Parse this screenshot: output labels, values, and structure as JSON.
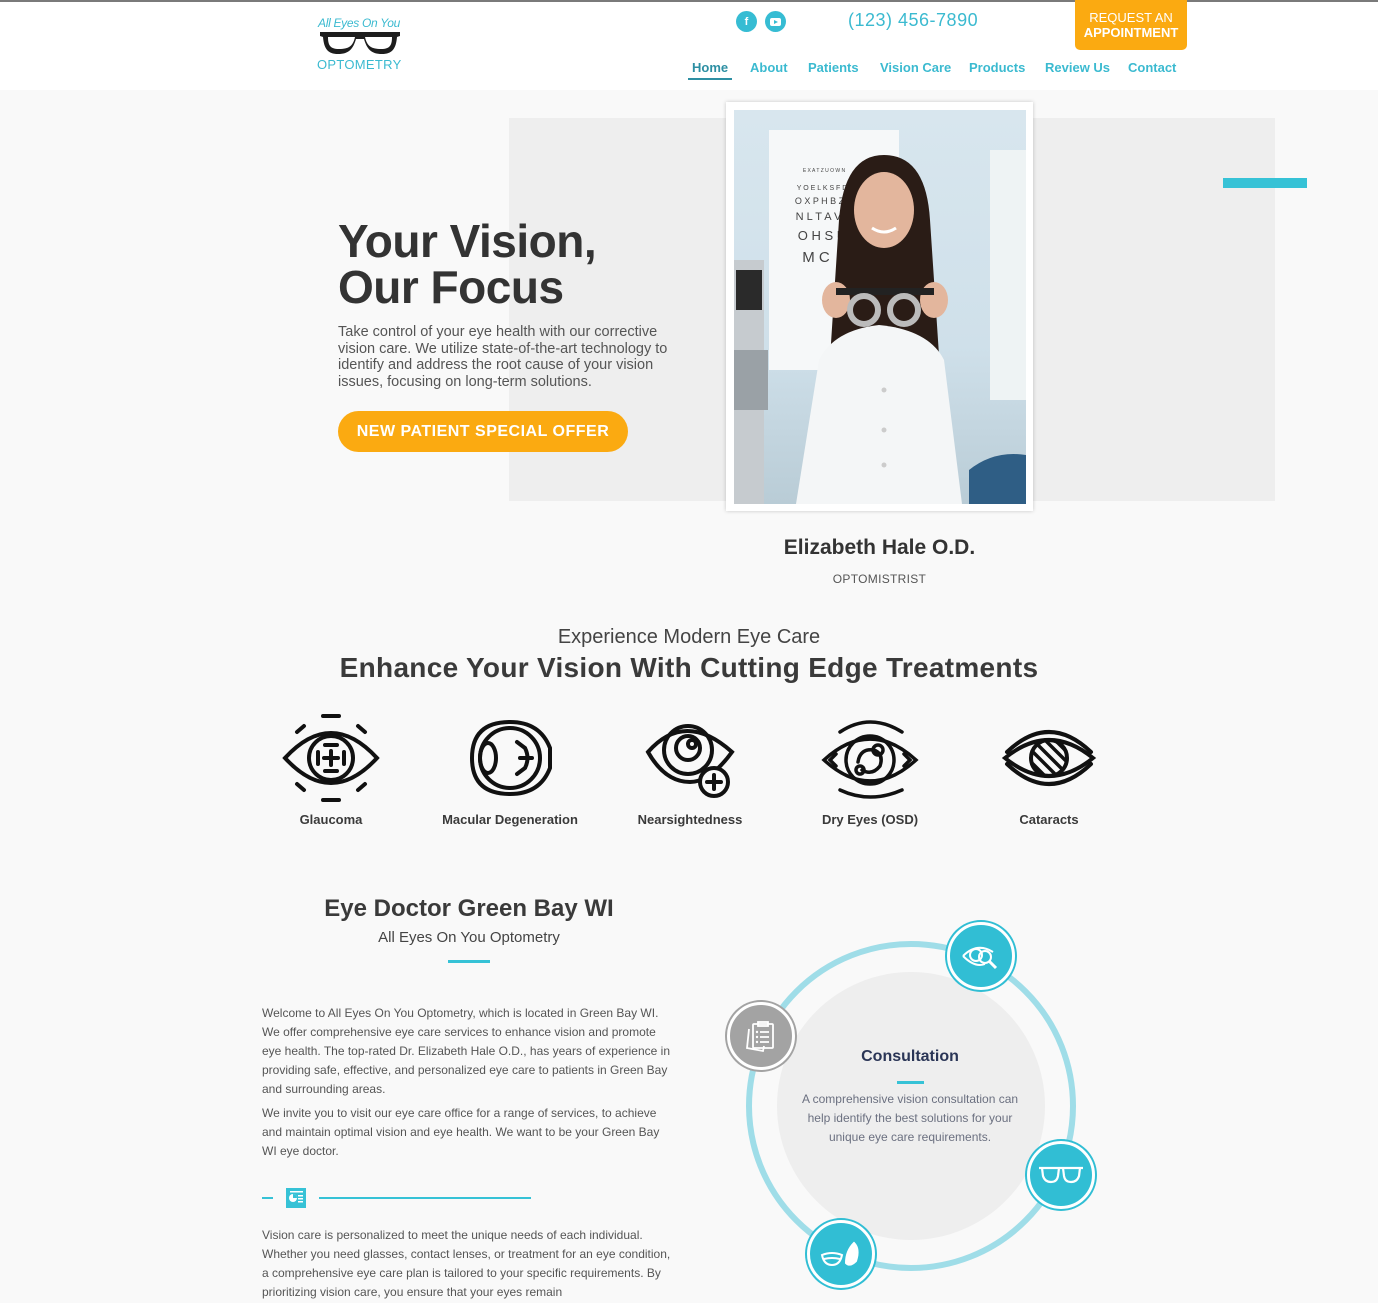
{
  "brand": {
    "logo_top": "All Eyes On You",
    "logo_bottom": "OPTOMETRY"
  },
  "header": {
    "social": [
      {
        "icon": "facebook-icon",
        "glyph": "f"
      },
      {
        "icon": "youtube-icon",
        "glyph": "▶"
      }
    ],
    "phone": "(123) 456-7890",
    "request_line1": "REQUEST AN",
    "request_line2": "APPOINTMENT"
  },
  "nav": {
    "items": [
      {
        "label": "Home",
        "active": true
      },
      {
        "label": "About"
      },
      {
        "label": "Patients"
      },
      {
        "label": "Vision Care"
      },
      {
        "label": "Products"
      },
      {
        "label": "Review Us"
      },
      {
        "label": "Contact"
      }
    ]
  },
  "hero": {
    "title_line1": "Your Vision,",
    "title_line2": "Our Focus",
    "text": "Take control of your eye health with our corrective vision care. We utilize state-of-the-art technology to identify and address the root cause of your vision issues, focusing on long-term solutions.",
    "cta": "NEW PATIENT SPECIAL OFFER",
    "doctor_name": "Elizabeth Hale O.D.",
    "doctor_title": "OPTOMISTRIST",
    "photo_alt": "Optometrist holding trial frame"
  },
  "treatments": {
    "subtitle": "Experience Modern Eye Care",
    "title": "Enhance Your Vision With Cutting Edge Treatments",
    "items": [
      {
        "label": "Glaucoma",
        "icon": "glaucoma-eye-icon"
      },
      {
        "label": "Macular Degeneration",
        "icon": "macular-eye-icon"
      },
      {
        "label": "Nearsightedness",
        "icon": "nearsighted-eye-icon"
      },
      {
        "label": "Dry Eyes (OSD)",
        "icon": "dry-eye-icon"
      },
      {
        "label": "Cataracts",
        "icon": "cataract-eye-icon"
      }
    ]
  },
  "about": {
    "title": "Eye Doctor Green Bay WI",
    "subtitle": "All Eyes On You Optometry",
    "para1": "Welcome to All Eyes On You Optometry, which is located in Green Bay WI. We offer comprehensive eye care services to enhance vision and promote eye health. The top-rated Dr. Elizabeth Hale O.D., has years of experience in providing safe, effective, and personalized eye care to patients in Green Bay and surrounding areas.",
    "para2": "We invite you to visit our eye care office for a range of services, to achieve and maintain optimal vision and eye health. We want to be your Green Bay WI eye doctor.",
    "para3": "Vision care is personalized to meet the unique needs of each individual. Whether you need glasses, contact lenses, or treatment for an eye condition, a comprehensive eye care plan is tailored to your specific requirements. By prioritizing vision care, you ensure that your eyes remain"
  },
  "services_wheel": {
    "active_title": "Consultation",
    "active_text": "A comprehensive vision consultation can help identify the best solutions for your unique eye care requirements.",
    "orbs": [
      {
        "name": "consultation",
        "icon": "clipboard-icon",
        "active": true
      },
      {
        "name": "eye-exam",
        "icon": "eye-magnifier-icon"
      },
      {
        "name": "glasses",
        "icon": "glasses-icon"
      },
      {
        "name": "contact-lenses",
        "icon": "contact-lens-icon"
      }
    ]
  },
  "colors": {
    "accent": "#36c2d6",
    "cta": "#fbaa11",
    "text": "#3a3a3a"
  }
}
